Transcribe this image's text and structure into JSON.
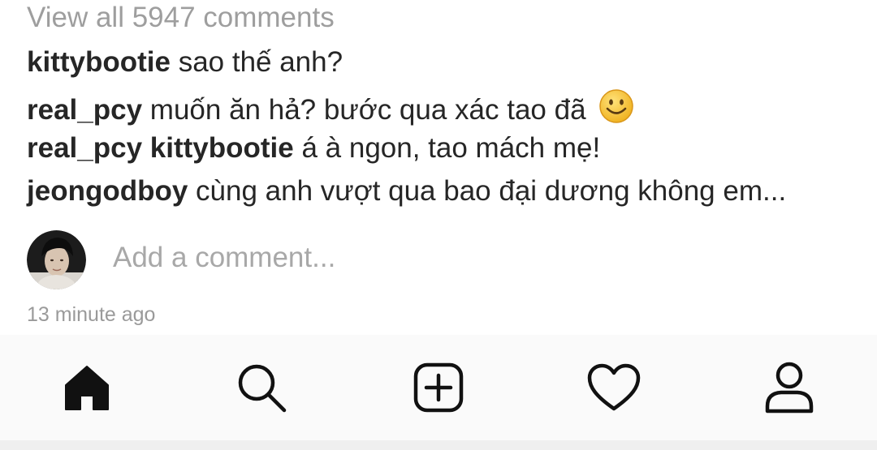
{
  "comments_link": "View all 5947 comments",
  "comments": [
    {
      "user": "kittybootie",
      "mention": "",
      "text": "sao thế anh?"
    },
    {
      "user": "real_pcy",
      "mention": "",
      "text": "muốn ăn hả? bước qua xác tao đã"
    },
    {
      "user": "real_pcy",
      "mention": "kittybootie",
      "text": "á à ngon, tao mách mẹ!"
    },
    {
      "user": "jeongodboy",
      "mention": "",
      "text": "cùng anh vượt qua bao đại dương không em..."
    }
  ],
  "add_comment": {
    "placeholder": "Add a comment...",
    "value": ""
  },
  "timestamp": "13 minute ago",
  "nav": {
    "items": [
      {
        "icon": "home-icon",
        "active": true
      },
      {
        "icon": "search-icon",
        "active": false
      },
      {
        "icon": "add-post-icon",
        "active": false
      },
      {
        "icon": "heart-icon",
        "active": false
      },
      {
        "icon": "profile-icon",
        "active": false
      }
    ]
  },
  "colors": {
    "text": "#262626",
    "muted": "#9e9e9e",
    "navbar_bg": "#fafafa",
    "emoji_yellow": "#f7c33a"
  }
}
